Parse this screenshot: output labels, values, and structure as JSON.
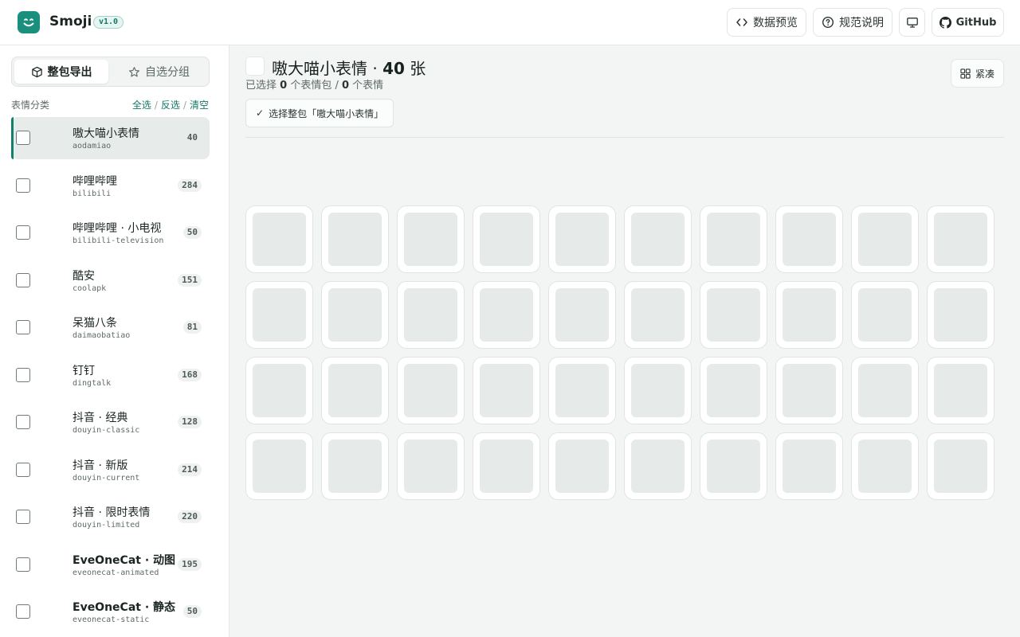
{
  "app": {
    "brand": "Smoji",
    "version": "v1.0"
  },
  "header": {
    "preview_label": "数据预览",
    "spec_label": "规范说明",
    "github_label": "GitHub"
  },
  "sidebar": {
    "tabs": [
      "整包导出",
      "自选分组"
    ],
    "section_label": "表情分类",
    "actions": [
      "全选",
      "反选",
      "清空"
    ],
    "items": [
      {
        "name": "嗷大喵小表情",
        "slug": "aodamiao",
        "count": "40"
      },
      {
        "name": "哔哩哔哩",
        "slug": "bilibili",
        "count": "284"
      },
      {
        "name": "哔哩哔哩 · 小电视",
        "slug": "bilibili-television",
        "count": "50"
      },
      {
        "name": "酷安",
        "slug": "coolapk",
        "count": "151"
      },
      {
        "name": "呆猫八条",
        "slug": "daimaobatiao",
        "count": "81"
      },
      {
        "name": "钉钉",
        "slug": "dingtalk",
        "count": "168"
      },
      {
        "name": "抖音 · 经典",
        "slug": "douyin-classic",
        "count": "128"
      },
      {
        "name": "抖音 · 新版",
        "slug": "douyin-current",
        "count": "214"
      },
      {
        "name": "抖音 · 限时表情",
        "slug": "douyin-limited",
        "count": "220"
      },
      {
        "name": "EveOneCat · 动图",
        "slug": "eveonecat-animated",
        "count": "195"
      },
      {
        "name": "EveOneCat · 静态",
        "slug": "eveonecat-static",
        "count": "50"
      }
    ]
  },
  "main": {
    "title_name": "嗷大喵小表情 · ",
    "title_count": "40",
    "title_unit": " 张",
    "subtitle_a": "已选择 ",
    "subtitle_packs": "0",
    "subtitle_b": " 个表情包 / ",
    "subtitle_items": "0",
    "subtitle_c": " 个表情",
    "select_pack_check": "✓",
    "select_pack_label": "选择整包「嗷大喵小表情」",
    "compact_label": "紧凑",
    "tile_count": 40
  },
  "colors": {
    "accent": "#13806e",
    "logo": "#1a8f7d"
  }
}
